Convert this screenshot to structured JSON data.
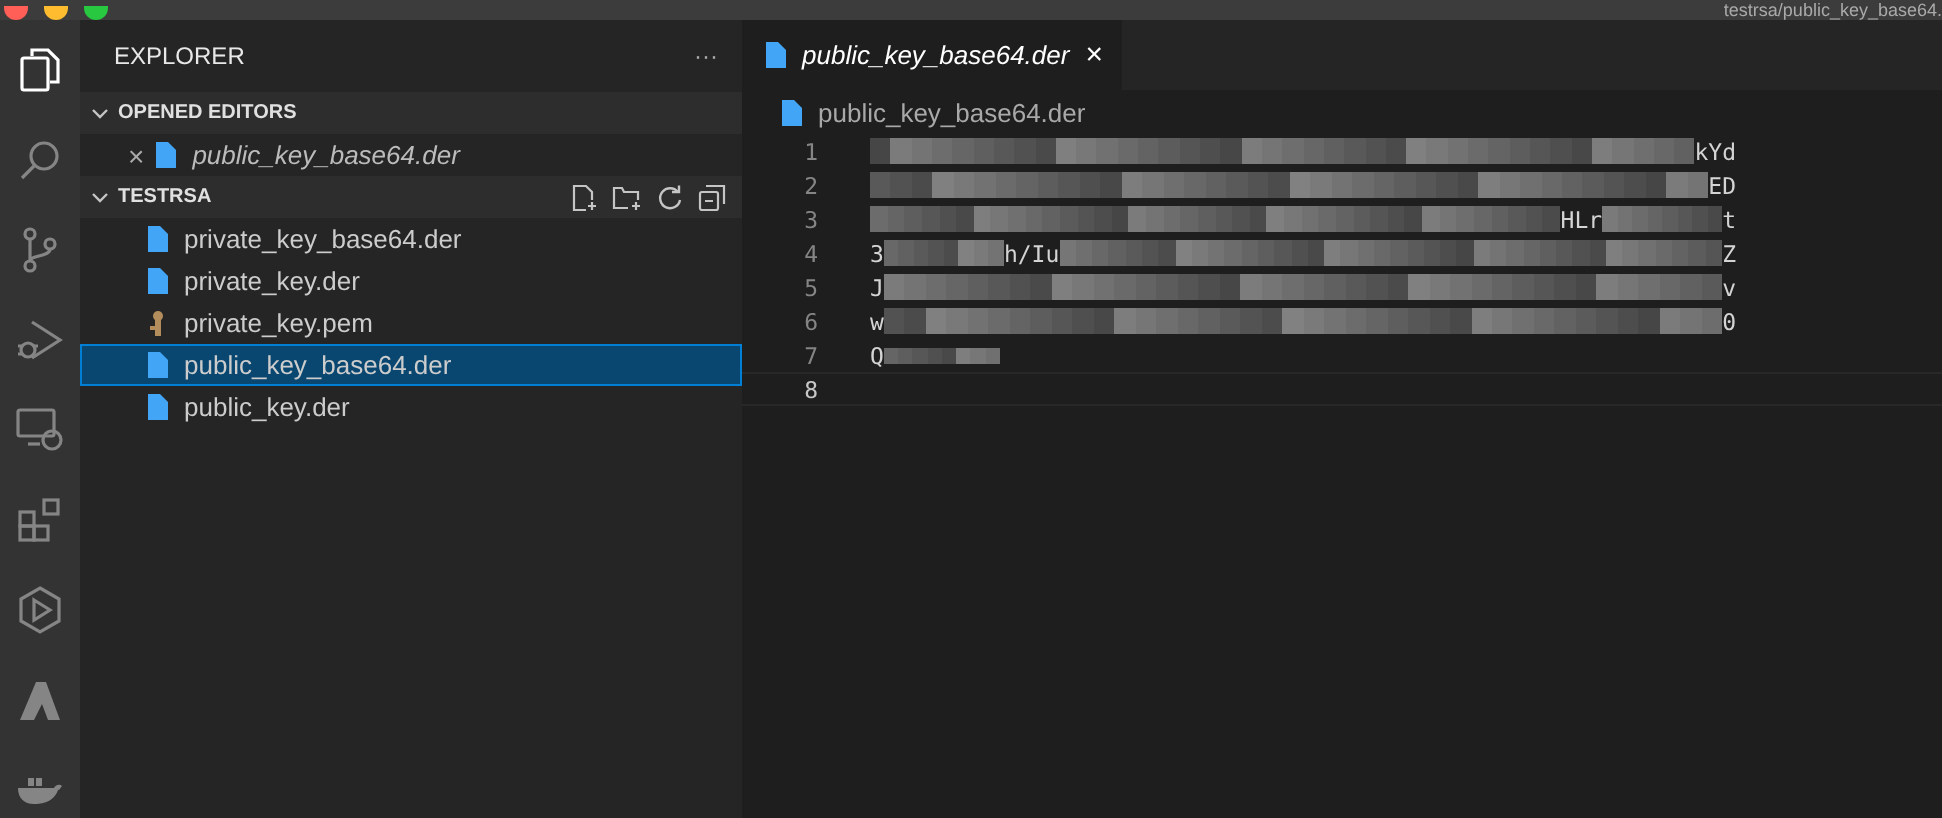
{
  "window": {
    "title": "testrsa/public_key_base64."
  },
  "activity_bar": [
    {
      "kind": "files",
      "selected": true
    },
    {
      "kind": "search",
      "selected": false
    },
    {
      "kind": "source_control",
      "selected": false
    },
    {
      "kind": "run_debug",
      "selected": false
    },
    {
      "kind": "remote",
      "selected": false
    },
    {
      "kind": "extensions",
      "selected": false
    },
    {
      "kind": "hexagon",
      "selected": false
    },
    {
      "kind": "azure",
      "selected": false
    },
    {
      "kind": "docker",
      "selected": false
    }
  ],
  "sidebar": {
    "title": "EXPLORER",
    "more": "···",
    "sections": [
      {
        "title": "OPENED EDITORS",
        "expanded": true,
        "items": [
          {
            "name": "public_key_base64.der",
            "kind": "file",
            "close": "×",
            "italic": true,
            "selected": false
          }
        ]
      },
      {
        "title": "TESTRSA",
        "expanded": true,
        "actions": [
          {
            "kind": "new_file"
          },
          {
            "kind": "new_folder"
          },
          {
            "kind": "refresh"
          },
          {
            "kind": "collapse"
          }
        ],
        "items": [
          {
            "name": "private_key_base64.der",
            "kind": "file",
            "selected": false
          },
          {
            "name": "private_key.der",
            "kind": "file",
            "selected": false
          },
          {
            "name": "private_key.pem",
            "kind": "key",
            "selected": false
          },
          {
            "name": "public_key_base64.der",
            "kind": "file",
            "selected": true
          },
          {
            "name": "public_key.der",
            "kind": "file",
            "selected": false
          }
        ]
      }
    ]
  },
  "tabs": [
    {
      "label": "public_key_base64.der",
      "close": "×",
      "selected": true
    }
  ],
  "breadcrumb": "public_key_base64.der",
  "editor": {
    "lines": [
      {
        "number": "1",
        "current": false,
        "segments": [
          {
            "kind": "redacted"
          },
          {
            "kind": "text",
            "text": "kYd"
          }
        ]
      },
      {
        "number": "2",
        "current": false,
        "segments": [
          {
            "kind": "redacted"
          },
          {
            "kind": "text",
            "text": "ED"
          }
        ]
      },
      {
        "number": "3",
        "current": false,
        "segments": [
          {
            "kind": "redacted"
          },
          {
            "kind": "text",
            "text": "HLr"
          },
          {
            "kind": "redacted_short"
          },
          {
            "kind": "text",
            "text": "t"
          }
        ]
      },
      {
        "number": "4",
        "current": false,
        "segments": [
          {
            "kind": "text",
            "text": "3"
          },
          {
            "kind": "redacted_short"
          },
          {
            "kind": "text",
            "text": "h/Iu"
          },
          {
            "kind": "redacted"
          },
          {
            "kind": "text",
            "text": "Z"
          }
        ]
      },
      {
        "number": "5",
        "current": false,
        "segments": [
          {
            "kind": "text",
            "text": "J"
          },
          {
            "kind": "redacted"
          },
          {
            "kind": "text",
            "text": "v"
          }
        ]
      },
      {
        "number": "6",
        "current": false,
        "segments": [
          {
            "kind": "text",
            "text": "w"
          },
          {
            "kind": "redacted"
          },
          {
            "kind": "text",
            "text": "0"
          }
        ]
      },
      {
        "number": "7",
        "current": false,
        "segments": [
          {
            "kind": "text",
            "text": "Q"
          },
          {
            "kind": "redacted_tail"
          }
        ]
      },
      {
        "number": "8",
        "current": true
      }
    ]
  }
}
